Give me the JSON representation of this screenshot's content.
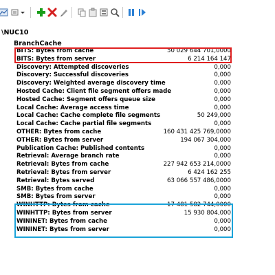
{
  "tree": {
    "computer": "\\NUC10",
    "object": "BranchCache"
  },
  "toolbar": {
    "icons": [
      "view-graph-icon",
      "change-graph-type-icon",
      "add-counter-icon",
      "delete-counter-icon",
      "highlight-icon",
      "copy-properties-icon",
      "paste-counter-list-icon",
      "properties-icon",
      "zoom-icon",
      "freeze-display-icon",
      "update-data-icon"
    ],
    "colors": {
      "add": "#1a9e1a",
      "delete": "#d42020",
      "play": "#2a7fd4"
    }
  },
  "counters": [
    {
      "name": "BITS: Bytes from cache",
      "value": "50 029 644 701,0000"
    },
    {
      "name": "BITS: Bytes from server",
      "value": "6 214 164 147"
    },
    {
      "name": "Discovery: Attempted discoveries",
      "value": "0,000"
    },
    {
      "name": "Discovery: Successful discoveries",
      "value": "0,000"
    },
    {
      "name": "Discovery: Weighted average discovery time",
      "value": "0,000"
    },
    {
      "name": "Hosted Cache: Client file segment offers made",
      "value": "0,000"
    },
    {
      "name": "Hosted Cache: Segment offers queue size",
      "value": "0,000"
    },
    {
      "name": "Local Cache: Average access time",
      "value": "0,000"
    },
    {
      "name": "Local Cache: Cache complete file segments",
      "value": "50 249,000"
    },
    {
      "name": "Local Cache: Cache partial file segments",
      "value": "0,000"
    },
    {
      "name": "OTHER: Bytes from cache",
      "value": "160 431 425 769,0000"
    },
    {
      "name": "OTHER: Bytes from server",
      "value": "194 067 304,000"
    },
    {
      "name": "Publication Cache: Published contents",
      "value": "0,000"
    },
    {
      "name": "Retrieval: Average branch rate",
      "value": "0,000"
    },
    {
      "name": "Retrieval: Bytes from cache",
      "value": "227 942 653 214,0000"
    },
    {
      "name": "Retrieval: Bytes from server",
      "value": "6 424 162 255"
    },
    {
      "name": "Retrieval: Bytes served",
      "value": "63 066 557 486,0000"
    },
    {
      "name": "SMB: Bytes from cache",
      "value": "0,000"
    },
    {
      "name": "SMB: Bytes from server",
      "value": "0,000"
    },
    {
      "name": "WINHTTP: Bytes from cache",
      "value": "17 481 582 744,0000"
    },
    {
      "name": "WINHTTP: Bytes from server",
      "value": "15 930 804,000"
    },
    {
      "name": "WININET: Bytes from cache",
      "value": "0,000"
    },
    {
      "name": "WININET: Bytes from server",
      "value": "0,000"
    }
  ],
  "highlights": {
    "red": "#e02020",
    "blue": "#1aa3d9"
  }
}
